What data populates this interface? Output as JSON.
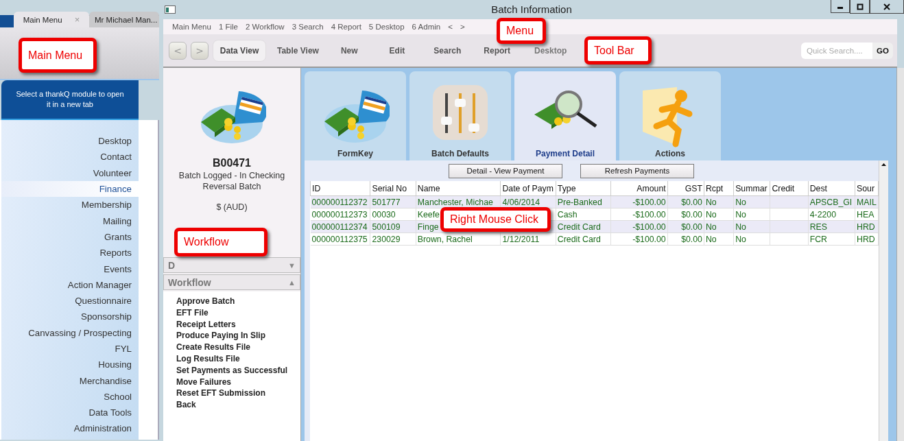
{
  "main_menu": {
    "tabs": [
      {
        "label": "Main Menu",
        "selected": true,
        "close": "×"
      },
      {
        "label": "Mr Michael Man...",
        "selected": false
      }
    ],
    "prompt": "Select a thankQ module to open it in a new tab",
    "modules": [
      {
        "label": "Desktop",
        "selected": false
      },
      {
        "label": "Contact",
        "selected": false
      },
      {
        "label": "Volunteer",
        "selected": false
      },
      {
        "label": "Finance",
        "selected": true
      },
      {
        "label": "Membership",
        "selected": false
      },
      {
        "label": "Mailing",
        "selected": false
      },
      {
        "label": "Grants",
        "selected": false
      },
      {
        "label": "Reports",
        "selected": false
      },
      {
        "label": "Events",
        "selected": false
      },
      {
        "label": "Action Manager",
        "selected": false
      },
      {
        "label": "Questionnaire",
        "selected": false
      },
      {
        "label": "Sponsorship",
        "selected": false
      },
      {
        "label": "Canvassing / Prospecting",
        "selected": false
      },
      {
        "label": "FYL",
        "selected": false
      },
      {
        "label": "Housing",
        "selected": false
      },
      {
        "label": "Merchandise",
        "selected": false
      },
      {
        "label": "School",
        "selected": false
      },
      {
        "label": "Data Tools",
        "selected": false
      },
      {
        "label": "Administration",
        "selected": false
      }
    ]
  },
  "batch_window": {
    "title": "Batch Information",
    "menu": [
      "Main Menu",
      "1 File",
      "2 Workflow",
      "3 Search",
      "4 Report",
      "5 Desktop",
      "6 Admin",
      "<",
      ">"
    ],
    "toolbar": {
      "nav": [
        "<",
        ">"
      ],
      "buttons": [
        {
          "label": "Data View",
          "selected": true,
          "disabled": false
        },
        {
          "label": "Table View",
          "selected": false,
          "disabled": false
        },
        {
          "label": "New",
          "selected": false,
          "disabled": false
        },
        {
          "label": "Edit",
          "selected": false,
          "disabled": false
        },
        {
          "label": "Search",
          "selected": false,
          "disabled": false
        },
        {
          "label": "Report",
          "selected": false,
          "disabled": false
        },
        {
          "label": "Desktop",
          "selected": false,
          "disabled": true
        }
      ],
      "search": {
        "placeholder": "Quick Search....",
        "button": "GO"
      }
    },
    "summary": {
      "batch_id": "B00471",
      "status": "Batch Logged - In Checking",
      "batch_type": "Reversal Batch",
      "currency": "$ (AUD)"
    },
    "sections": [
      {
        "label": "D",
        "toggle": "▼"
      },
      {
        "label": "Workflow",
        "toggle": "▲",
        "items": [
          "Approve Batch",
          "EFT File",
          "Receipt Letters",
          "Produce Paying In Slip",
          "Create Results File",
          "Log Results File",
          "Set Payments as Successful",
          "Move Failures",
          "Reset EFT Submission",
          "Back"
        ]
      }
    ],
    "tiles": [
      {
        "label": "FormKey",
        "selected": false
      },
      {
        "label": "Batch Defaults",
        "selected": false
      },
      {
        "label": "Payment Detail",
        "selected": true
      },
      {
        "label": "Actions",
        "selected": false
      }
    ],
    "actions": [
      "Detail - View Payment",
      "Refresh Payments"
    ],
    "table": {
      "columns": [
        "ID",
        "Serial No",
        "Name",
        "Date of Paym",
        "Type",
        "Amount",
        "GST",
        "Rcpt",
        "Summar",
        "Credit",
        "Dest",
        "Sour"
      ],
      "rows": [
        [
          "000000112372",
          "501777",
          "Manchester, Michae",
          "4/06/2014",
          "Pre-Banked",
          "-$100.00",
          "$0.00",
          "No",
          "No",
          null,
          "APSCB_GI",
          "MAIL"
        ],
        [
          "000000112373",
          "00030",
          "Keefe",
          null,
          "Cash",
          "-$100.00",
          "$0.00",
          "No",
          "No",
          null,
          "4-2200",
          "HEA"
        ],
        [
          "000000112374",
          "500109",
          "Finge",
          null,
          "Credit Card",
          "-$100.00",
          "$0.00",
          "No",
          "No",
          null,
          "RES",
          "HRD"
        ],
        [
          "000000112375",
          "230029",
          "Brown, Rachel",
          "1/12/2011",
          "Credit Card",
          "-$100.00",
          "$0.00",
          "No",
          "No",
          null,
          "FCR",
          "HRD"
        ]
      ]
    }
  },
  "callouts": [
    {
      "text": "Main Menu"
    },
    {
      "text": "Menu"
    },
    {
      "text": "Tool Bar"
    },
    {
      "text": "Workflow"
    },
    {
      "text": "Right Mouse Click"
    }
  ]
}
